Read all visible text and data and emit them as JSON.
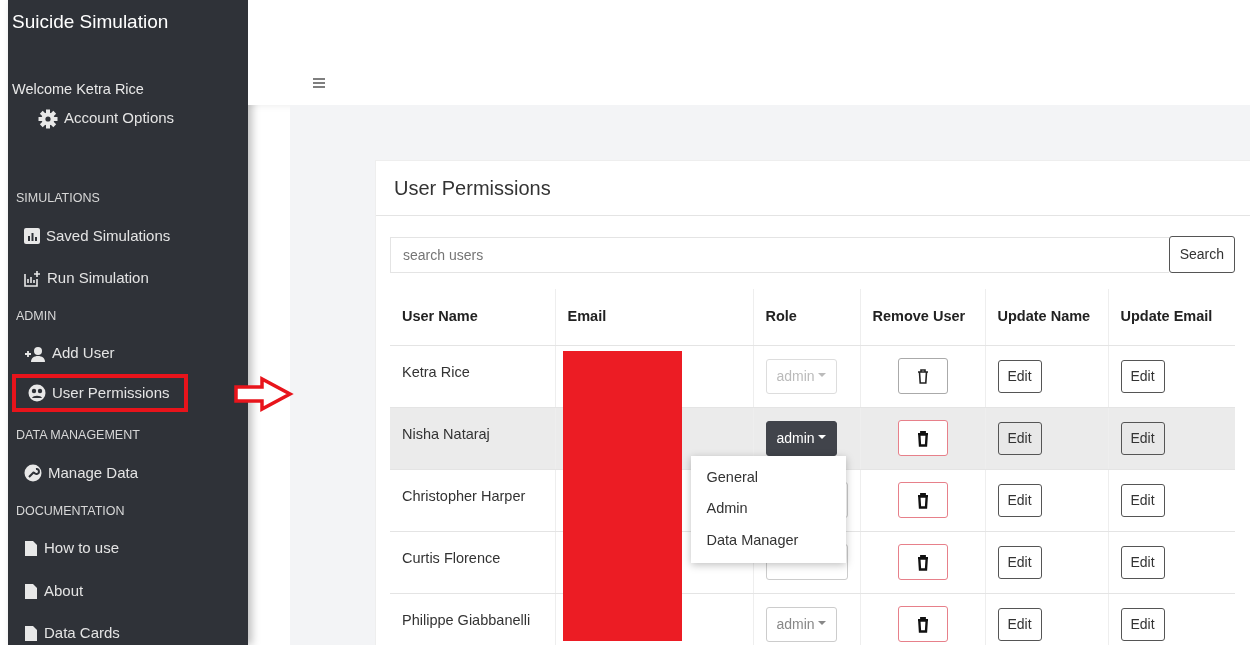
{
  "sidebar": {
    "title": "Suicide Simulation",
    "welcome": "Welcome Ketra Rice",
    "account_option": "Account Options",
    "sections": [
      {
        "heading": "SIMULATIONS",
        "items": [
          {
            "label": "Saved Simulations",
            "highlighted": false
          },
          {
            "label": "Run Simulation",
            "highlighted": false
          }
        ]
      },
      {
        "heading": "ADMIN",
        "items": [
          {
            "label": "Add User",
            "highlighted": false
          },
          {
            "label": "User Permissions",
            "highlighted": true
          }
        ]
      },
      {
        "heading": "DATA MANAGEMENT",
        "items": [
          {
            "label": "Manage Data",
            "highlighted": false
          }
        ]
      },
      {
        "heading": "DOCUMENTATION",
        "items": [
          {
            "label": "How to use",
            "highlighted": false
          },
          {
            "label": "About",
            "highlighted": false
          },
          {
            "label": "Data Cards",
            "highlighted": false
          }
        ]
      }
    ]
  },
  "card": {
    "title": "User Permissions",
    "search": {
      "placeholder": "search users",
      "button": "Search"
    },
    "table": {
      "columns": [
        "User Name",
        "Email",
        "Role",
        "Remove User",
        "Update Name",
        "Update Email"
      ],
      "email_redacted": true,
      "rows": [
        {
          "user_name": "Ketra Rice",
          "role": {
            "value": "admin",
            "disabled": true,
            "open": false
          },
          "remove_disabled": true,
          "hovered": false,
          "update_name": "Edit",
          "update_email": "Edit"
        },
        {
          "user_name": "Nisha Nataraj",
          "role": {
            "value": "admin",
            "disabled": false,
            "open": true,
            "options": [
              "General",
              "Admin",
              "Data Manager"
            ]
          },
          "remove_disabled": false,
          "hovered": true,
          "update_name": "Edit",
          "update_email": "Edit"
        },
        {
          "user_name": "Christopher Harper",
          "remove_disabled": false,
          "hovered": false,
          "update_name": "Edit",
          "update_email": "Edit"
        },
        {
          "user_name": "Curtis Florence",
          "remove_disabled": false,
          "hovered": false,
          "update_name": "Edit",
          "update_email": "Edit"
        },
        {
          "user_name": "Philippe Giabbanelli",
          "role": {
            "value": "admin",
            "disabled": false,
            "open": false
          },
          "remove_disabled": false,
          "hovered": false,
          "update_name": "Edit",
          "update_email": "Edit"
        }
      ]
    }
  }
}
